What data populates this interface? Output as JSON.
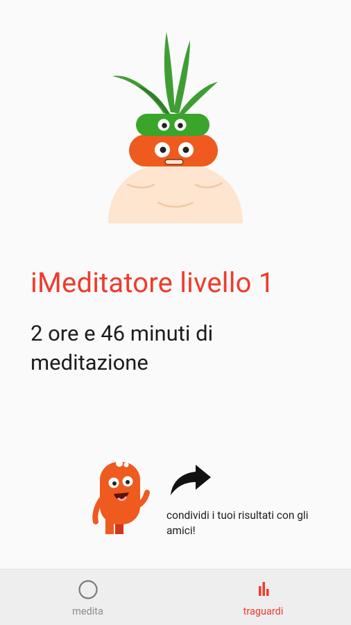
{
  "achievement": {
    "level_title": "iMeditatore livello 1",
    "time_summary": "2 ore e 46 minuti di meditazione"
  },
  "share": {
    "text": "condividi i tuoi risultati con gli amici!"
  },
  "nav": {
    "items": [
      {
        "label": "medita",
        "icon": "circle-icon",
        "active": false
      },
      {
        "label": "traguardi",
        "icon": "bar-chart-icon",
        "active": true
      }
    ]
  },
  "colors": {
    "accent": "#ef3b2c",
    "inactive": "#8d8d8d",
    "nav_background": "#eeeeee"
  }
}
